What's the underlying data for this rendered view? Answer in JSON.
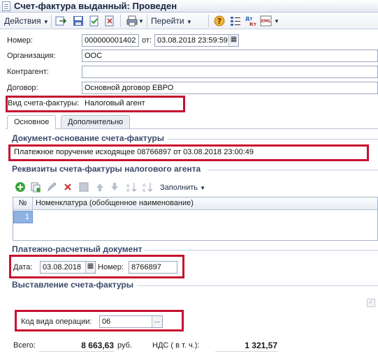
{
  "window": {
    "title": "Счет-фактура выданный: Проведен"
  },
  "toolbar": {
    "actions_label": "Действия",
    "goto_label": "Перейти"
  },
  "header": {
    "number_label": "Номер:",
    "number_value": "000000001402",
    "from_label": "от:",
    "date_value": "03.08.2018 23:59:59",
    "organization_label": "Организация:",
    "organization_value": "ООС",
    "counterparty_label": "Контрагент:",
    "counterparty_value": "",
    "contract_label": "Договор:",
    "contract_value": "Основной договор ЕВРО",
    "invoice_type_label": "Вид счета-фактуры:",
    "invoice_type_value": "Налоговый агент"
  },
  "tabs": [
    {
      "label": "Основное"
    },
    {
      "label": "Дополнительно"
    }
  ],
  "base_doc": {
    "section_title": "Документ-основание счета-фактуры",
    "value": "Платежное поручение исходящее 08766897 от 03.08.2018 23:00:49"
  },
  "agent": {
    "section_title": "Реквизиты счета-фактуры налогового агента",
    "fill_label": "Заполнить",
    "columns": [
      "№",
      "Номенклатура (обобщенное наименование)"
    ],
    "rows": [
      {
        "num": "1",
        "name": ""
      }
    ]
  },
  "payment": {
    "section_title": "Платежно-расчетный документ",
    "date_label": "Дата:",
    "date_value": "03.08.2018",
    "number_label": "Номер:",
    "number_value": "8766897"
  },
  "issue": {
    "section_title": "Выставление счета-фактуры",
    "operation_code_label": "Код вида операции:",
    "operation_code_value": "06"
  },
  "totals": {
    "total_label": "Всего:",
    "total_value": "8 663,63",
    "currency": "руб.",
    "vat_label": "НДС ( в т. ч.):",
    "vat_value": "1 321,57"
  },
  "colors": {
    "highlight": "#c8102e",
    "section_title": "#3b4a6b",
    "selected_row": "#8fb2e3"
  }
}
